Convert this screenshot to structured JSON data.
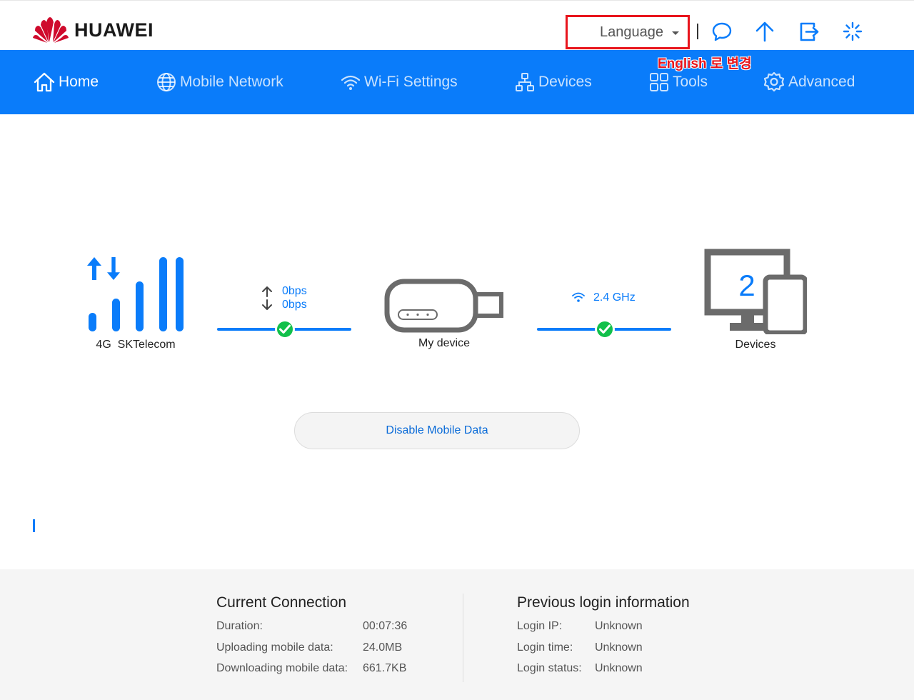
{
  "brand": {
    "name": "HUAWEI"
  },
  "header": {
    "language_label": "Language",
    "annotation": "English 로 변경",
    "icons": [
      "message-icon",
      "update-icon",
      "logout-icon",
      "loading-icon"
    ]
  },
  "nav": {
    "items": [
      {
        "label": "Home",
        "icon": "home-icon",
        "active": true
      },
      {
        "label": "Mobile Network",
        "icon": "globe-icon"
      },
      {
        "label": "Wi-Fi Settings",
        "icon": "wifi-icon"
      },
      {
        "label": "Devices",
        "icon": "network-tree-icon"
      },
      {
        "label": "Tools",
        "icon": "grid-icon"
      },
      {
        "label": "Advanced",
        "icon": "settings-icon"
      }
    ]
  },
  "status": {
    "network_type": "4G",
    "operator": "SKTelecom",
    "upload_rate": "0bps",
    "download_rate": "0bps",
    "device_label": "My device",
    "wifi_band": "2.4 GHz",
    "devices_count": "2",
    "devices_label": "Devices",
    "disable_button": "Disable Mobile Data"
  },
  "colors": {
    "accent": "#0a7cfa",
    "ok": "#12c04a",
    "annotation": "#e8141c"
  },
  "footer": {
    "current": {
      "title": "Current Connection",
      "rows": [
        {
          "label": "Duration:",
          "value": "00:07:36"
        },
        {
          "label": "Uploading mobile data:",
          "value": "24.0MB"
        },
        {
          "label": "Downloading mobile data:",
          "value": "661.7KB"
        }
      ]
    },
    "previous": {
      "title": "Previous login information",
      "rows": [
        {
          "label": "Login IP:",
          "value": "Unknown"
        },
        {
          "label": "Login time:",
          "value": "Unknown"
        },
        {
          "label": "Login status:",
          "value": "Unknown"
        }
      ]
    }
  }
}
